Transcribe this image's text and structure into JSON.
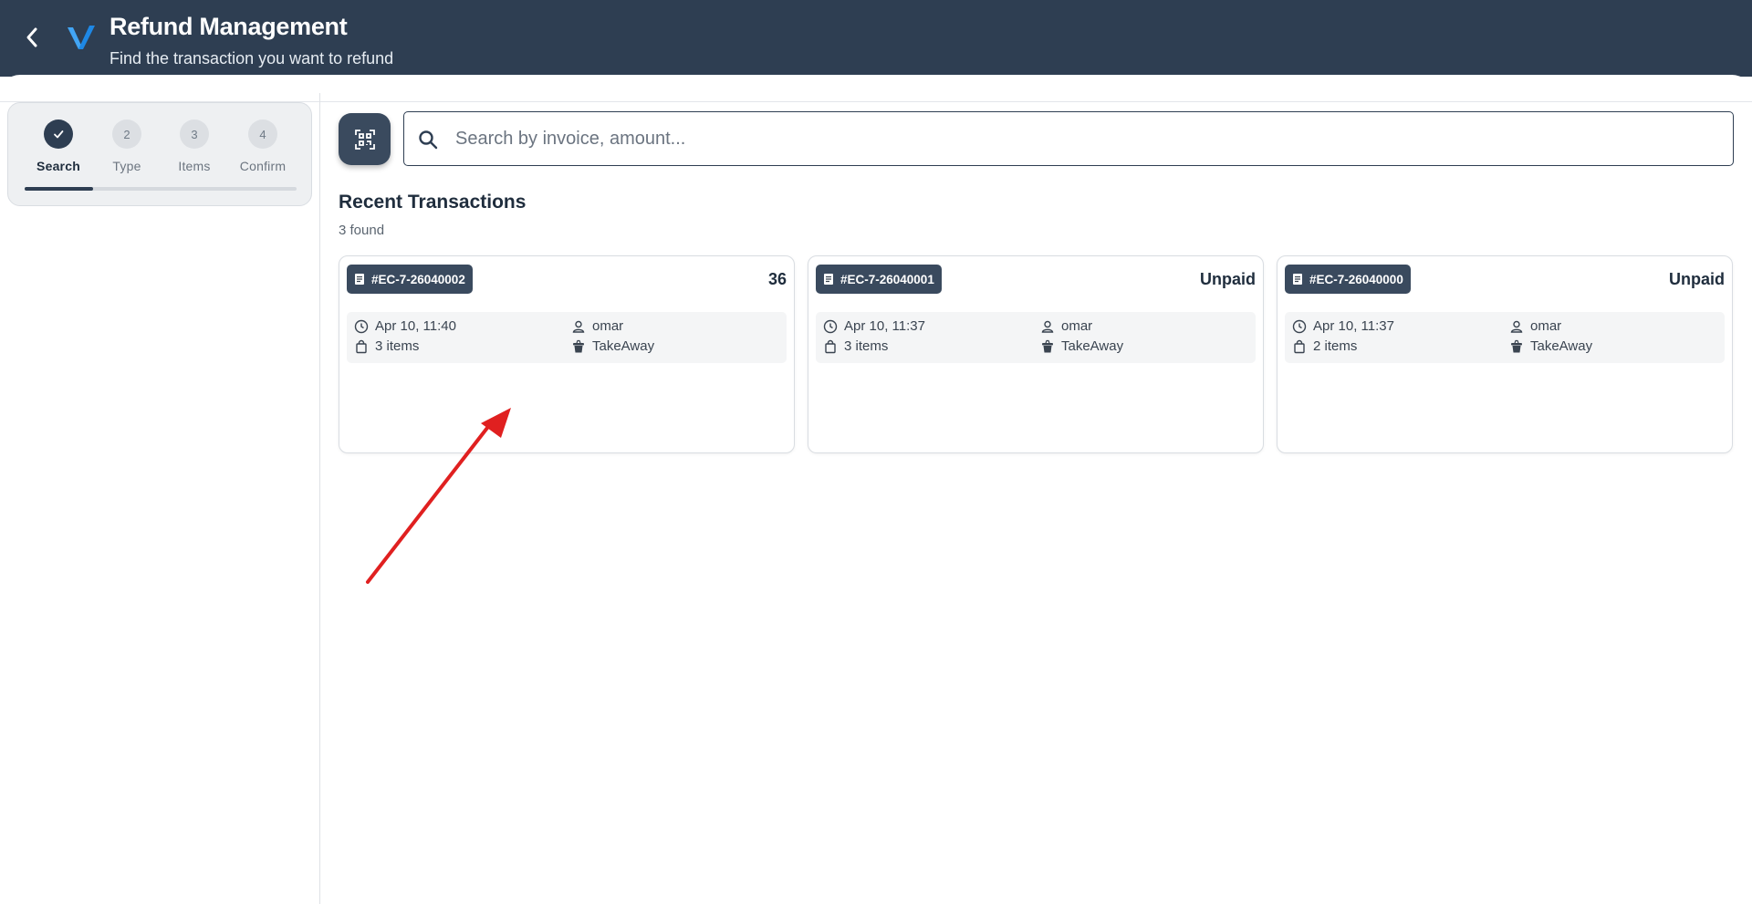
{
  "header": {
    "title": "Refund Management",
    "subtitle": "Find the transaction you want to refund"
  },
  "stepper": {
    "steps": [
      {
        "number": "",
        "label": "Search",
        "state": "completed"
      },
      {
        "number": "2",
        "label": "Type",
        "state": "pending"
      },
      {
        "number": "3",
        "label": "Items",
        "state": "pending"
      },
      {
        "number": "4",
        "label": "Confirm",
        "state": "pending"
      }
    ],
    "progress": 0.25
  },
  "search": {
    "placeholder": "Search by invoice, amount...",
    "value": ""
  },
  "transactions": {
    "title": "Recent Transactions",
    "count_label": "3 found",
    "cards": [
      {
        "invoice": "#EC-7-26040002",
        "amount": "36",
        "datetime": "Apr 10, 11:40",
        "user": "omar",
        "items": "3 items",
        "order_type": "TakeAway"
      },
      {
        "invoice": "#EC-7-26040001",
        "amount": "Unpaid",
        "datetime": "Apr 10, 11:37",
        "user": "omar",
        "items": "3 items",
        "order_type": "TakeAway"
      },
      {
        "invoice": "#EC-7-26040000",
        "amount": "Unpaid",
        "datetime": "Apr 10, 11:37",
        "user": "omar",
        "items": "2 items",
        "order_type": "TakeAway"
      }
    ]
  },
  "colors": {
    "header_bg": "#2e3e52",
    "accent_logo": "#1e88e5",
    "annotation_arrow": "#e02020"
  }
}
